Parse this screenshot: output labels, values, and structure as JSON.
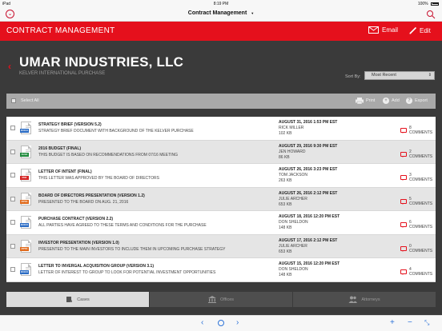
{
  "status": {
    "device": "iPad",
    "time": "8:19 PM",
    "battery": "100%"
  },
  "nav": {
    "title": "Contract Management",
    "caret": "▼"
  },
  "appbar": {
    "title": "CONTRACT MANAGEMENT",
    "email_label": "Email",
    "edit_label": "Edit"
  },
  "header": {
    "company": "UMAR INDUSTRIES, LLC",
    "subtitle": "KELVER INTERNATIONAL PURCHASE",
    "sort_label": "Sort By:",
    "sort_value": "Most Recent"
  },
  "toolbar": {
    "select_all": "Select All",
    "print": "Print",
    "add": "Add",
    "export": "Export"
  },
  "documents": [
    {
      "title": "STRATEGY BRIEF (VERSION 5.2)",
      "description": "STRATEGY BRIEF DOCUMENT WITH BACKGROUND OF THE KELVER PURCHASE",
      "date": "AUGUST 31, 2016     1:53 PM EST",
      "author": "RICK MILLER",
      "size": "102 KB",
      "comments": "8 COMMENTS",
      "type": "DOCX",
      "color": "#2b6cc4"
    },
    {
      "title": "2016 BUDGET (FINAL)",
      "description": "THIS BUDGET IS BASED ON RECOMMENDATIONS FROM 07/16 MEETING",
      "date": "AUGUST 29, 2016     9:30 PM EST",
      "author": "JEN HOWARD",
      "size": "86 KB",
      "comments": "2 COMMENTS",
      "type": "XLSX",
      "color": "#1f8a3c"
    },
    {
      "title": "LETTER OF INTENT (FINAL)",
      "description": "THIS LETTER WAS APPROVED BY THE BOARD OF DIRECTORS",
      "date": "AUGUST 26, 2016     3:23 PM EST",
      "author": "TOM JACKSON",
      "size": "263 KB",
      "comments": "3 COMMENTS",
      "type": "PDF",
      "color": "#d42424"
    },
    {
      "title": "BOARD OF DIRECTORS PRESENTATION (VERSION 1.2)",
      "description": "PRESENTED TO THE BOARD ON AUG. 21, 2016",
      "date": "AUGUST 26, 2016     2:12 PM EST",
      "author": "JULIE ARCHER",
      "size": "653 KB",
      "comments": "5 COMMENTS",
      "type": "PPTX",
      "color": "#e06a1c"
    },
    {
      "title": "PURCHASE CONTRACT (VERSION 2.2)",
      "description": "ALL PARTIES HAVE AGREED TO THESE TERMS AND CONDITIONS FOR THE PURCHASE",
      "date": "AUGUST 18, 2016     12:20 PM EST",
      "author": "DON SHELDON",
      "size": "148 KB",
      "comments": "6 COMMENTS",
      "type": "DOCX",
      "color": "#2b6cc4"
    },
    {
      "title": "INVESTOR PRESENTATION (VERSION 1.0)",
      "description": "PRESENTED TO THE MAIN INVESTORS TO INCLUDE THEM IN UPCOMING PURCHASE STRATEGY",
      "date": "AUGUST 17, 2016     2:12 PM EST",
      "author": "JULIE ARCHER",
      "size": "653 KB",
      "comments": "0 COMMENTS",
      "type": "PPTX",
      "color": "#e06a1c"
    },
    {
      "title": "LETTER TO INVERGAL ACQUISITION GROUP (VERSION 3.1)",
      "description": "LETTER OF INTEREST TO GROUP TO LOOK FOR POTENTIAL INVESTMENT OPPORTUNITIES",
      "date": "AUGUST 15, 2016     12:20 PM EST",
      "author": "DON SHELDON",
      "size": "148 KB",
      "comments": "4 COMMENTS",
      "type": "DOCX",
      "color": "#2b6cc4"
    }
  ],
  "tabs": [
    {
      "label": "Cases"
    },
    {
      "label": "Offices"
    },
    {
      "label": "Attorneys"
    }
  ],
  "colors": {
    "accent": "#e5101c",
    "browser_blue": "#2d73d8"
  }
}
